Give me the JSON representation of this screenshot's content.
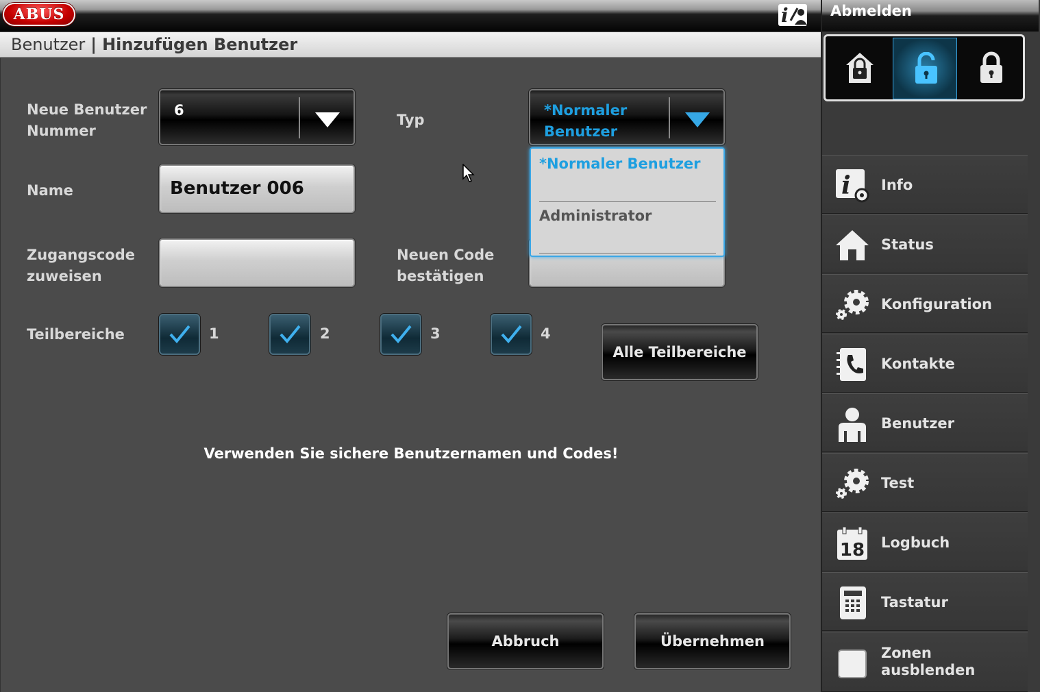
{
  "header": {
    "logo_text": "ABUS",
    "logout_label": "Abmelden"
  },
  "breadcrumb": {
    "parent": "Benutzer",
    "separator": "|",
    "current": "Hinzufügen Benutzer"
  },
  "form": {
    "user_number_label": "Neue Benutzer Nummer",
    "user_number_value": "6",
    "typ_label": "Typ",
    "typ_value": "*Normaler Benutzer",
    "typ_options": [
      "*Normaler Benutzer",
      "Administrator"
    ],
    "name_label": "Name",
    "name_value": "Benutzer 006",
    "code_label": "Zugangscode zuweisen",
    "code_value": "",
    "confirm_label": "Neuen Code bestätigen",
    "confirm_value": "",
    "areas_label": "Teilbereiche",
    "areas": [
      {
        "label": "1",
        "checked": true
      },
      {
        "label": "2",
        "checked": true
      },
      {
        "label": "3",
        "checked": true
      },
      {
        "label": "4",
        "checked": true
      }
    ],
    "all_areas_label": "Alle Teilbereiche",
    "hint": "Verwenden Sie sichere Benutzernamen und Codes!",
    "cancel_label": "Abbruch",
    "apply_label": "Übernehmen"
  },
  "sidebar": {
    "lock_states": [
      "locked-home",
      "unlocked",
      "locked"
    ],
    "active_lock": 1,
    "items": [
      {
        "label": "Info",
        "icon": "info-gear-icon"
      },
      {
        "label": "Status",
        "icon": "home-icon"
      },
      {
        "label": "Konfiguration",
        "icon": "gears-icon"
      },
      {
        "label": "Kontakte",
        "icon": "phonebook-icon"
      },
      {
        "label": "Benutzer",
        "icon": "user-icon"
      },
      {
        "label": "Test",
        "icon": "gears-icon"
      },
      {
        "label": "Logbuch",
        "icon": "calendar-icon"
      },
      {
        "label": "Tastatur",
        "icon": "keypad-icon"
      },
      {
        "label": "Zonen ausblenden",
        "icon": "checkbox-icon"
      }
    ],
    "calendar_day": "18"
  },
  "colors": {
    "accent": "#1e9fe0",
    "logo_red": "#c50000"
  }
}
